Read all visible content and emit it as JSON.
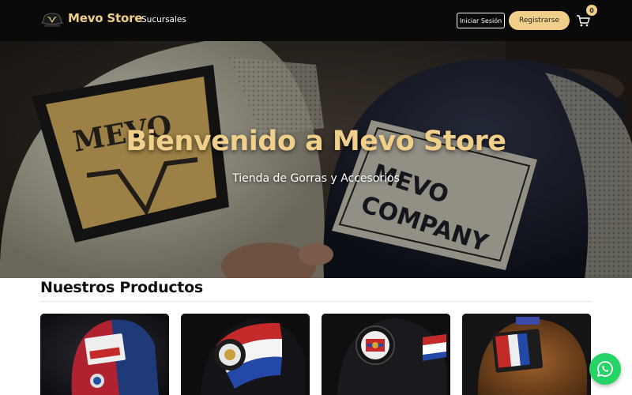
{
  "navbar": {
    "brand": "Mevo Store",
    "links": [
      {
        "label": "Sucursales"
      }
    ],
    "login_label": "Iniciar Sesión",
    "register_label": "Registrarse",
    "cart_count": "0"
  },
  "hero": {
    "title": "Bienvenido a Mevo Store",
    "subtitle": "Tienda de Gorras y Accesorios"
  },
  "products": {
    "title": "Nuestros Productos",
    "items": [
      {
        "image": "red-blue-trucker-cap"
      },
      {
        "image": "paraguay-flag-cap"
      },
      {
        "image": "black-cap-round-patch"
      },
      {
        "image": "brown-terere-cap"
      }
    ]
  },
  "whatsapp": {
    "icon": "whatsapp-icon"
  },
  "colors": {
    "accent": "#f0cf8a",
    "navbar_bg": "#0a0a0a",
    "whatsapp": "#25d366"
  }
}
